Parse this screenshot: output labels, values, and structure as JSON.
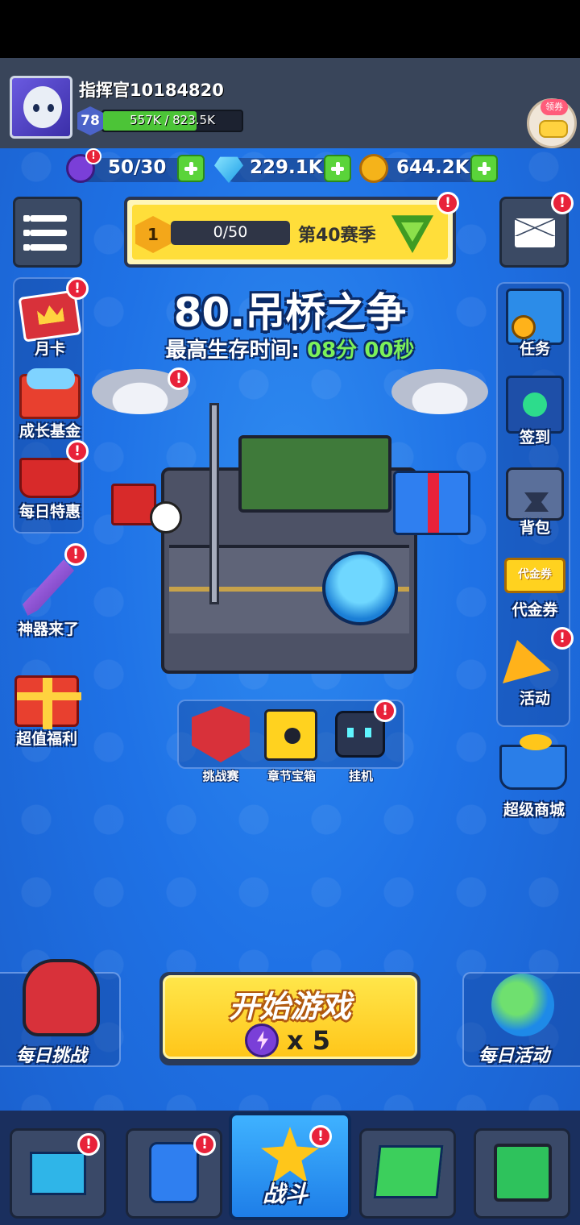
{
  "player": {
    "name": "指挥官10184820",
    "level": "78",
    "xp_text": "557K / 823.5K",
    "xp_fraction": 0.676
  },
  "coupon_button": {
    "tag": "领券"
  },
  "currencies": {
    "energy": {
      "value": "50/30",
      "icon": "energy-bolt-icon"
    },
    "diamonds": {
      "value": "229.1K",
      "icon": "diamond-icon"
    },
    "coins": {
      "value": "644.2K",
      "icon": "gold-coin-icon"
    }
  },
  "season": {
    "rank": "1",
    "progress": "0/50",
    "label": "第40赛季"
  },
  "level": {
    "title": "80.吊桥之争",
    "survive_label": "最高生存时间:",
    "survive_value": "08分 00秒"
  },
  "left_side": [
    {
      "label": "月卡",
      "icon": "month-card-icon"
    },
    {
      "label": "成长基金",
      "icon": "growth-fund-icon"
    },
    {
      "label": "每日特惠",
      "icon": "daily-deal-basket-icon"
    },
    {
      "label": "神器来了",
      "icon": "artifact-sword-icon"
    },
    {
      "label": "超值福利",
      "icon": "gift-box-icon"
    }
  ],
  "right_side": [
    {
      "label": "任务",
      "icon": "quest-book-icon"
    },
    {
      "label": "签到",
      "icon": "checkin-card-icon"
    },
    {
      "label": "背包",
      "icon": "backpack-icon"
    },
    {
      "label": "代金券",
      "icon": "voucher-icon"
    },
    {
      "label": "代金券_tag",
      "text": "代金券"
    },
    {
      "label": "活动",
      "icon": "party-popper-icon"
    },
    {
      "label": "超级商城",
      "icon": "shopping-cart-icon"
    }
  ],
  "modes": [
    {
      "label": "挑战赛",
      "icon": "crossed-swords-icon"
    },
    {
      "label": "章节宝箱",
      "icon": "chapter-chest-icon"
    },
    {
      "label": "挂机",
      "icon": "idle-robot-icon"
    }
  ],
  "start": {
    "label": "开始游戏",
    "cost": "x 5"
  },
  "daily": {
    "challenge": "每日挑战",
    "activity": "每日活动"
  },
  "nav": {
    "battle": "战斗"
  },
  "colors": {
    "background": "#1f72e6",
    "topbar": "#39455a",
    "accent_yellow": "#ffd21f",
    "badge_red": "#e8223a",
    "survive_green": "#7cf05a"
  }
}
